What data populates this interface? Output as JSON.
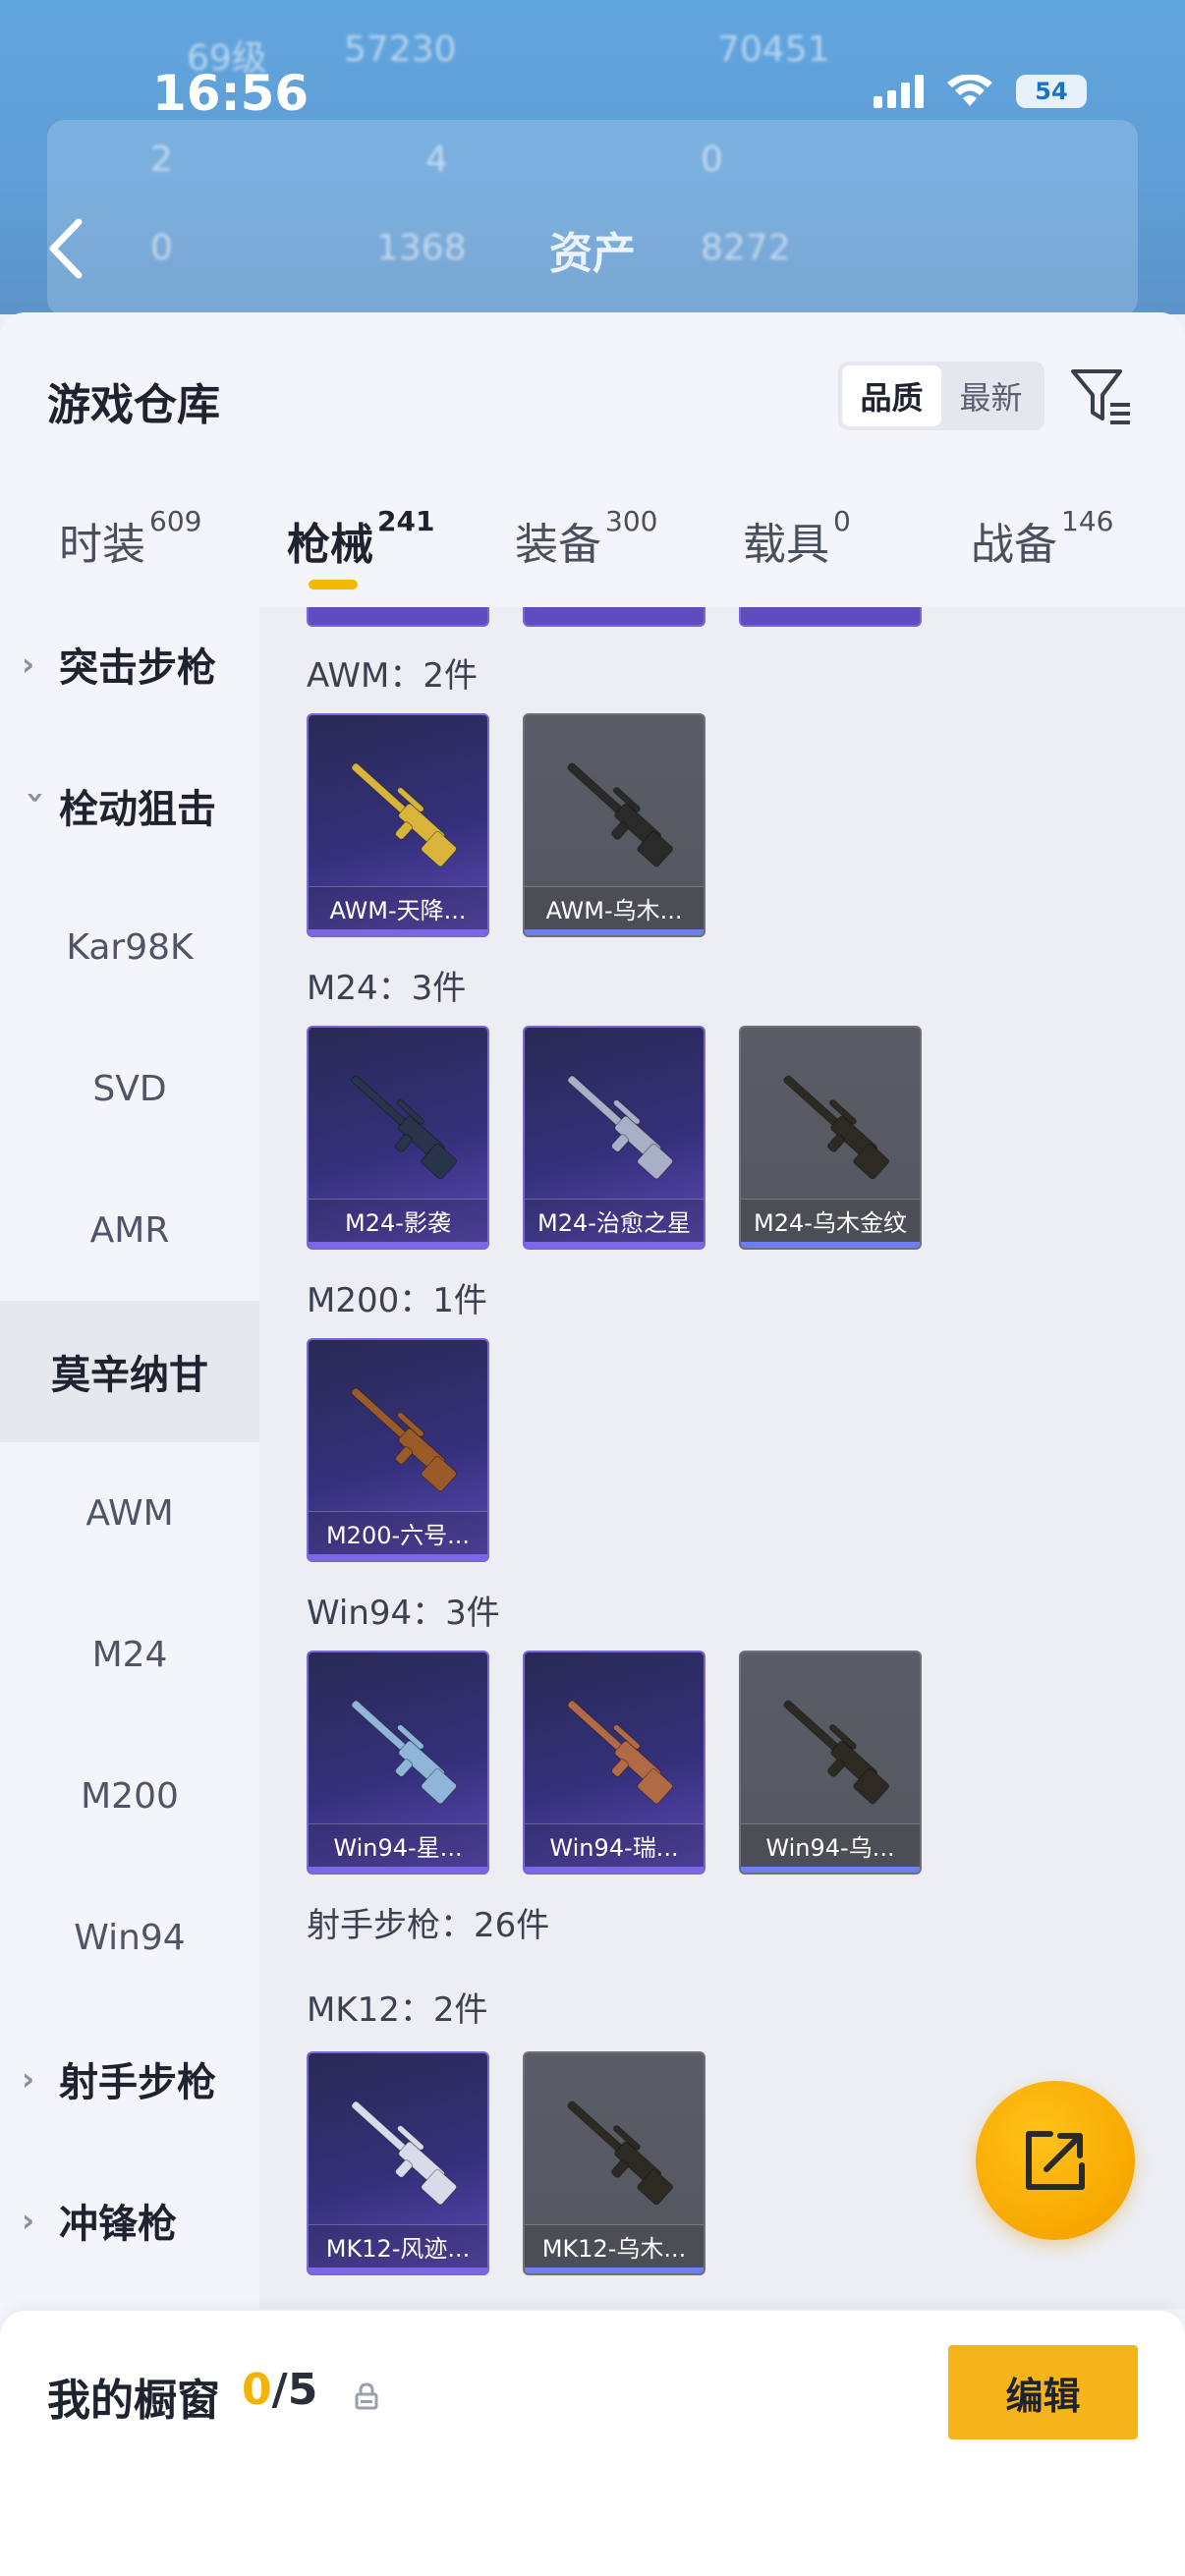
{
  "status_bar": {
    "time": "16:56",
    "battery": "54"
  },
  "background": {
    "title": "资产",
    "level_text": "69级",
    "coins": "57230",
    "other_value": "70451",
    "stats_row1": [
      "2",
      "4",
      "0"
    ],
    "stats_row2": [
      "0",
      "1368",
      "8272"
    ]
  },
  "sheet": {
    "title": "游戏仓库",
    "sort_options": [
      "品质",
      "最新"
    ],
    "tabs": [
      {
        "label": "时装",
        "count": "609"
      },
      {
        "label": "枪械",
        "count": "241"
      },
      {
        "label": "装备",
        "count": "300"
      },
      {
        "label": "载具",
        "count": "0"
      },
      {
        "label": "战备",
        "count": "146"
      }
    ]
  },
  "sidebar": {
    "items": [
      {
        "label": "突击步枪",
        "type": "group",
        "expanded": false
      },
      {
        "label": "栓动狙击",
        "type": "group",
        "expanded": true
      },
      {
        "label": "Kar98K",
        "type": "sub"
      },
      {
        "label": "SVD",
        "type": "sub"
      },
      {
        "label": "AMR",
        "type": "sub"
      },
      {
        "label": "莫辛纳甘",
        "type": "sub",
        "selected": true
      },
      {
        "label": "AWM",
        "type": "sub"
      },
      {
        "label": "M24",
        "type": "sub"
      },
      {
        "label": "M200",
        "type": "sub"
      },
      {
        "label": "Win94",
        "type": "sub"
      },
      {
        "label": "射手步枪",
        "type": "group",
        "expanded": false
      },
      {
        "label": "冲锋枪",
        "type": "group",
        "expanded": false
      }
    ]
  },
  "content": {
    "sections": [
      {
        "label": "AWM：2件",
        "items": [
          {
            "name": "AWM-天降...",
            "rarity": "purple",
            "gun_color": "#d9b43a"
          },
          {
            "name": "AWM-乌木...",
            "rarity": "gray",
            "gun_color": "#2a2a2a"
          }
        ]
      },
      {
        "label": "M24：3件",
        "items": [
          {
            "name": "M24-影袭",
            "rarity": "purple",
            "gun_color": "#27344a"
          },
          {
            "name": "M24-治愈之星",
            "rarity": "purple",
            "gun_color": "#a8b0c8"
          },
          {
            "name": "M24-乌木金纹",
            "rarity": "gray",
            "gun_color": "#2c2a22"
          }
        ]
      },
      {
        "label": "M200：1件",
        "items": [
          {
            "name": "M200-六号...",
            "rarity": "purple",
            "gun_color": "#9a5a2a"
          }
        ]
      },
      {
        "label": "Win94：3件",
        "items": [
          {
            "name": "Win94-星...",
            "rarity": "purple",
            "gun_color": "#8fb6d8"
          },
          {
            "name": "Win94-瑞...",
            "rarity": "purple",
            "gun_color": "#b06a45"
          },
          {
            "name": "Win94-乌...",
            "rarity": "gray",
            "gun_color": "#2c2a22"
          }
        ]
      },
      {
        "label": "射手步枪：26件",
        "items": []
      },
      {
        "label": "MK12：2件",
        "items": [
          {
            "name": "MK12-风迹...",
            "rarity": "purple",
            "gun_color": "#d8dcea"
          },
          {
            "name": "MK12-乌木...",
            "rarity": "gray",
            "gun_color": "#2c2a22"
          }
        ]
      }
    ]
  },
  "bottom_bar": {
    "label": "我的橱窗",
    "count_current": "0",
    "count_total": "/5",
    "edit_label": "编辑"
  },
  "colors": {
    "accent": "#f5b800",
    "purple_rarity": "#5f4ab8",
    "gray_rarity": "#5a5d66"
  }
}
